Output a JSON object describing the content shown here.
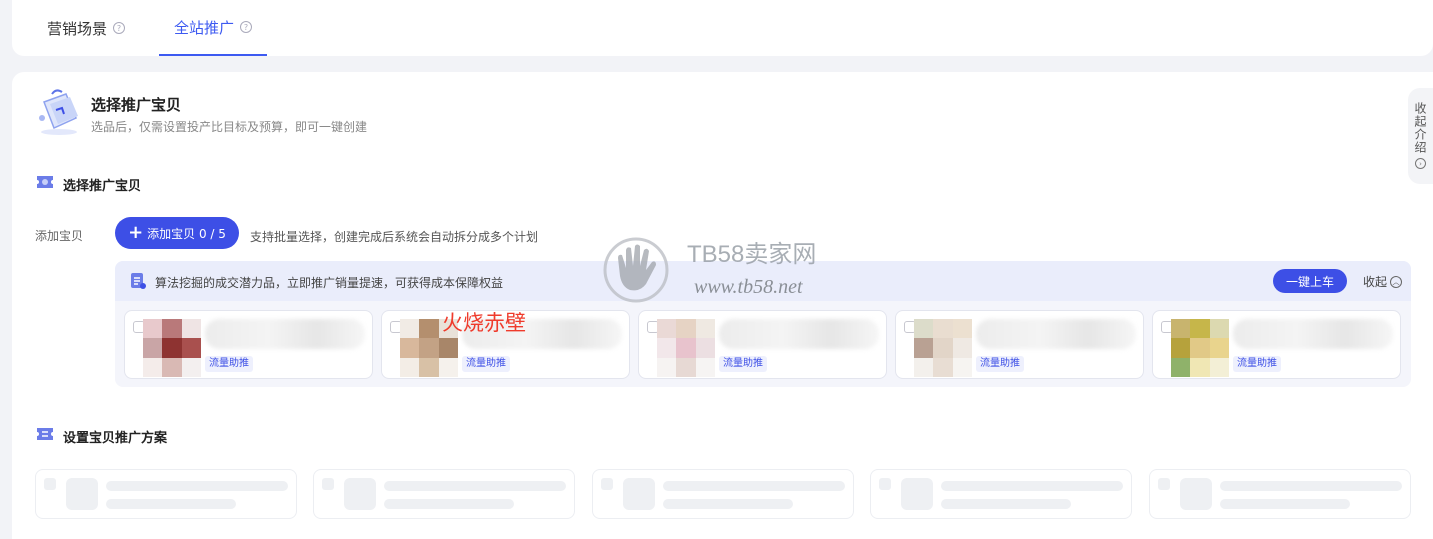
{
  "tabs": [
    {
      "label": "营销场景",
      "active": false
    },
    {
      "label": "全站推广",
      "active": true
    }
  ],
  "tab_help_glyph": "?",
  "hero": {
    "title": "选择推广宝贝",
    "subtitle": "选品后，仅需设置投产比目标及预算，即可一键创建"
  },
  "section1": {
    "title": "选择推广宝贝"
  },
  "add_item": {
    "label": "添加宝贝",
    "button_label": "添加宝贝 0 / 5",
    "hint": "支持批量选择，创建完成后系统会自动拆分成多个计划"
  },
  "recommend": {
    "text": "算法挖掘的成交潜力品，立即推广销量提速，可获得成本保障权益",
    "onekey_label": "一键上车",
    "collapse_label": "收起"
  },
  "products": [
    {
      "tag": "流量助推"
    },
    {
      "tag": "流量助推"
    },
    {
      "tag": "流量助推"
    },
    {
      "tag": "流量助推"
    },
    {
      "tag": "流量助推"
    }
  ],
  "section2": {
    "title": "设置宝贝推广方案"
  },
  "side_tab": {
    "label": "收起介绍"
  },
  "watermark": {
    "brand": "TB58卖家网",
    "url": "www.tb58.net",
    "overlay": "火烧赤壁"
  },
  "colors": {
    "accent": "#3d4fe6",
    "tab_active": "#3d5af1",
    "watermark_red": "#ef3b2c"
  }
}
